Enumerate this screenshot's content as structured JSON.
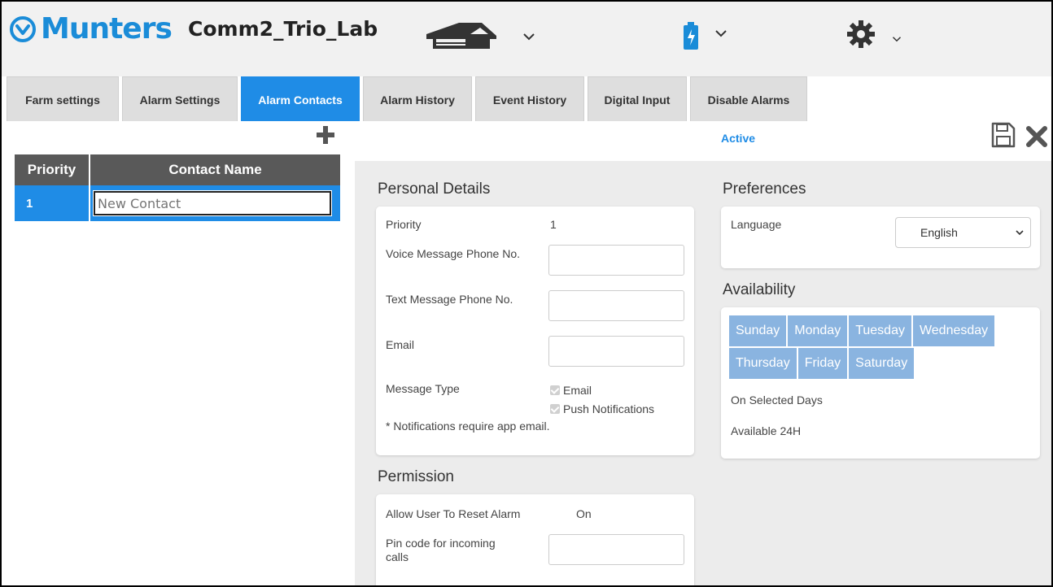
{
  "header": {
    "brand": "Munters",
    "site_name": "Comm2_Trio_Lab",
    "colors": {
      "brand": "#1a8cd8",
      "accent": "#1f8ce6",
      "header_bg": "#f1f1f1"
    }
  },
  "tabs": [
    {
      "label": "Farm settings",
      "active": false
    },
    {
      "label": "Alarm Settings",
      "active": false
    },
    {
      "label": "Alarm Contacts",
      "active": true
    },
    {
      "label": "Alarm History",
      "active": false
    },
    {
      "label": "Event History",
      "active": false
    },
    {
      "label": "Digital Input",
      "active": false
    },
    {
      "label": "Disable Alarms",
      "active": false
    }
  ],
  "contacts_table": {
    "headers": [
      "Priority",
      "Contact Name"
    ],
    "rows": [
      {
        "priority": "1",
        "name_placeholder": "New Contact",
        "name_value": ""
      }
    ]
  },
  "status": {
    "label": "Active"
  },
  "personal_details": {
    "title": "Personal Details",
    "priority_label": "Priority",
    "priority_value": "1",
    "voice_label": "Voice Message Phone No.",
    "text_label": "Text Message Phone No.",
    "email_label": "Email",
    "message_type_label": "Message Type",
    "message_type_options": [
      "Email",
      "Push Notifications"
    ],
    "note": "* Notifications require app email."
  },
  "permission": {
    "title": "Permission",
    "reset_label": "Allow User To Reset Alarm",
    "reset_value": "On",
    "pin_label": "Pin code for incoming calls"
  },
  "preferences": {
    "title": "Preferences",
    "language_label": "Language",
    "language_value": "English"
  },
  "availability": {
    "title": "Availability",
    "days": [
      "Sunday",
      "Monday",
      "Tuesday",
      "Wednesday",
      "Thursday",
      "Friday",
      "Saturday"
    ],
    "mode_label": "On Selected Days",
    "hours_label": "Available 24H"
  }
}
